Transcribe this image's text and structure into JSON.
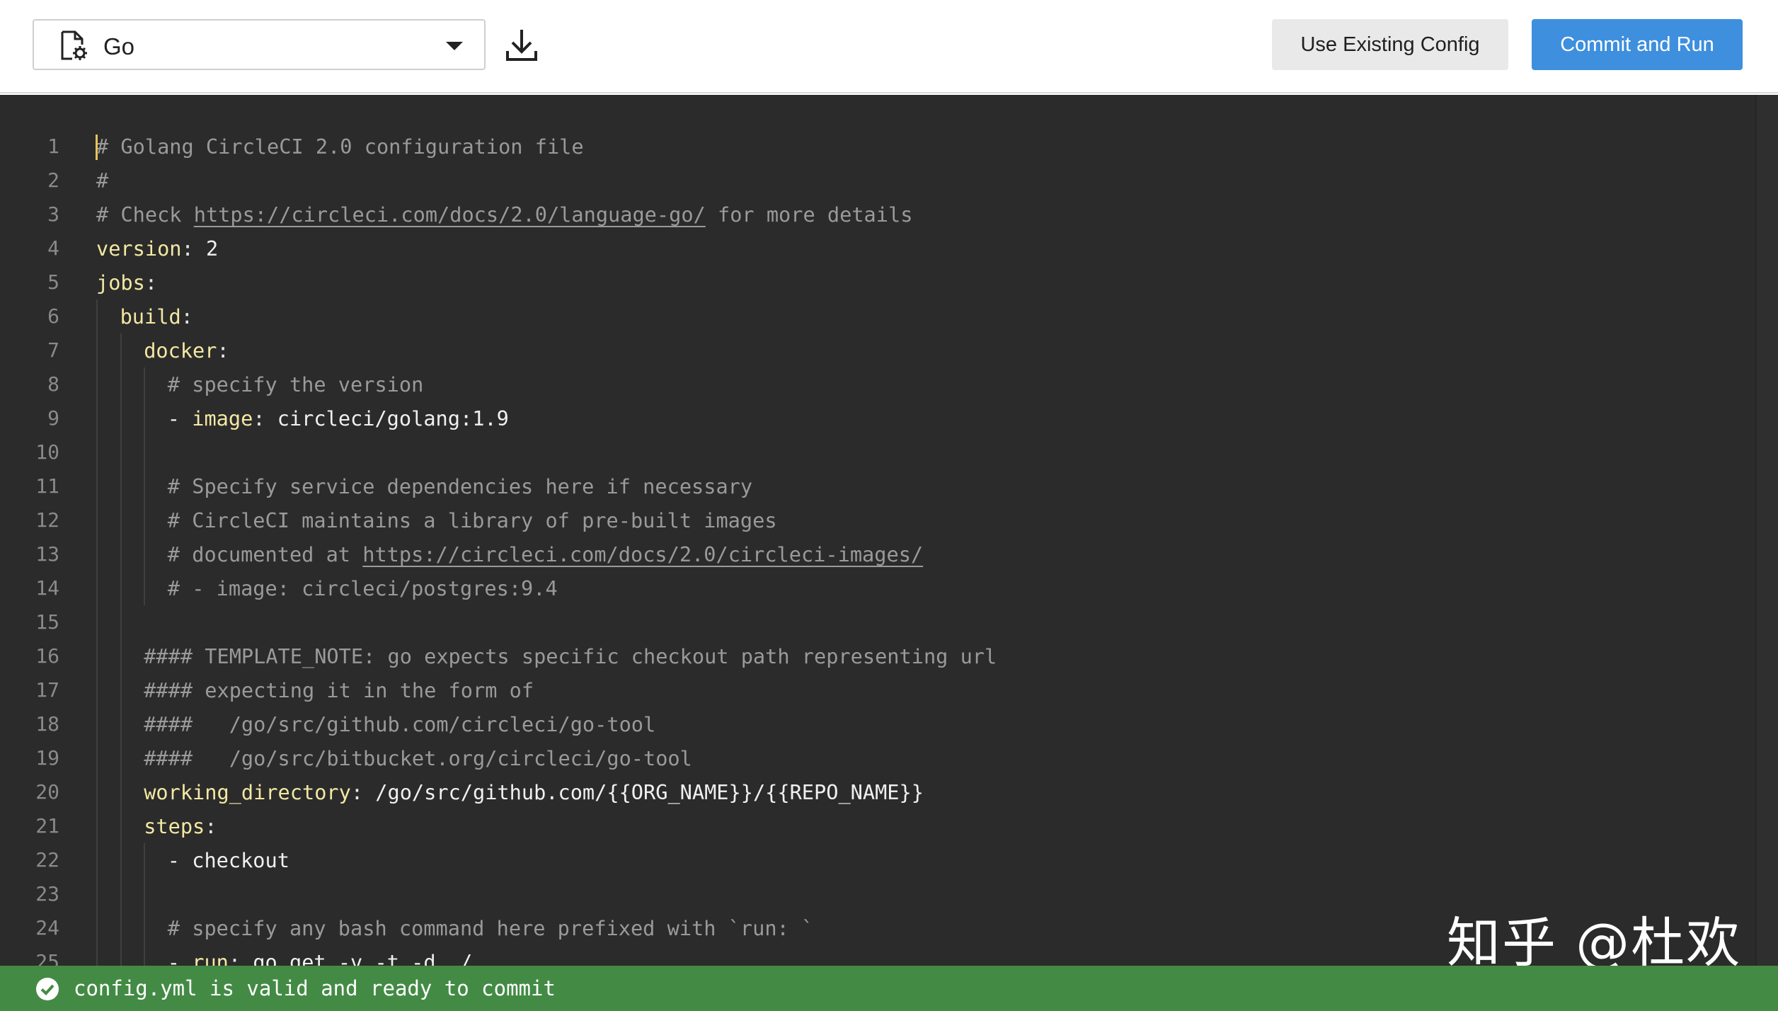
{
  "toolbar": {
    "language_select_value": "Go",
    "use_existing_label": "Use Existing Config",
    "commit_label": "Commit and Run"
  },
  "editor": {
    "lines": [
      {
        "n": "1",
        "indent": 0,
        "segs": [
          {
            "t": "# Golang CircleCI 2.0 configuration file",
            "c": "comment"
          }
        ]
      },
      {
        "n": "2",
        "indent": 0,
        "segs": [
          {
            "t": "#",
            "c": "comment"
          }
        ]
      },
      {
        "n": "3",
        "indent": 0,
        "segs": [
          {
            "t": "# Check ",
            "c": "comment"
          },
          {
            "t": "https://circleci.com/docs/2.0/language-go/",
            "c": "link"
          },
          {
            "t": " for more details",
            "c": "comment"
          }
        ]
      },
      {
        "n": "4",
        "indent": 0,
        "segs": [
          {
            "t": "version",
            "c": "key"
          },
          {
            "t": ": ",
            "c": "punct"
          },
          {
            "t": "2",
            "c": "plain"
          }
        ]
      },
      {
        "n": "5",
        "indent": 0,
        "segs": [
          {
            "t": "jobs",
            "c": "key"
          },
          {
            "t": ":",
            "c": "punct"
          }
        ]
      },
      {
        "n": "6",
        "indent": 1,
        "segs": [
          {
            "t": "build",
            "c": "key"
          },
          {
            "t": ":",
            "c": "punct"
          }
        ]
      },
      {
        "n": "7",
        "indent": 2,
        "segs": [
          {
            "t": "docker",
            "c": "key"
          },
          {
            "t": ":",
            "c": "punct"
          }
        ]
      },
      {
        "n": "8",
        "indent": 3,
        "segs": [
          {
            "t": "# specify the version",
            "c": "comment"
          }
        ]
      },
      {
        "n": "9",
        "indent": 3,
        "segs": [
          {
            "t": "- ",
            "c": "plain"
          },
          {
            "t": "image",
            "c": "key"
          },
          {
            "t": ": ",
            "c": "punct"
          },
          {
            "t": "circleci/golang:1.9",
            "c": "plain"
          }
        ]
      },
      {
        "n": "10",
        "indent": 3,
        "segs": []
      },
      {
        "n": "11",
        "indent": 3,
        "segs": [
          {
            "t": "# Specify service dependencies here if necessary",
            "c": "comment"
          }
        ]
      },
      {
        "n": "12",
        "indent": 3,
        "segs": [
          {
            "t": "# CircleCI maintains a library of pre-built images",
            "c": "comment"
          }
        ]
      },
      {
        "n": "13",
        "indent": 3,
        "segs": [
          {
            "t": "# documented at ",
            "c": "comment"
          },
          {
            "t": "https://circleci.com/docs/2.0/circleci-images/",
            "c": "link"
          }
        ]
      },
      {
        "n": "14",
        "indent": 3,
        "segs": [
          {
            "t": "# - image: circleci/postgres:9.4",
            "c": "comment"
          }
        ]
      },
      {
        "n": "15",
        "indent": 2,
        "segs": []
      },
      {
        "n": "16",
        "indent": 2,
        "segs": [
          {
            "t": "#### TEMPLATE_NOTE: go expects specific checkout path representing url",
            "c": "comment"
          }
        ]
      },
      {
        "n": "17",
        "indent": 2,
        "segs": [
          {
            "t": "#### expecting it in the form of",
            "c": "comment"
          }
        ]
      },
      {
        "n": "18",
        "indent": 2,
        "segs": [
          {
            "t": "####   /go/src/github.com/circleci/go-tool",
            "c": "comment"
          }
        ]
      },
      {
        "n": "19",
        "indent": 2,
        "segs": [
          {
            "t": "####   /go/src/bitbucket.org/circleci/go-tool",
            "c": "comment"
          }
        ]
      },
      {
        "n": "20",
        "indent": 2,
        "segs": [
          {
            "t": "working_directory",
            "c": "key"
          },
          {
            "t": ": ",
            "c": "punct"
          },
          {
            "t": "/go/src/github.com/{{ORG_NAME}}/{{REPO_NAME}}",
            "c": "plain"
          }
        ]
      },
      {
        "n": "21",
        "indent": 2,
        "segs": [
          {
            "t": "steps",
            "c": "key"
          },
          {
            "t": ":",
            "c": "punct"
          }
        ]
      },
      {
        "n": "22",
        "indent": 3,
        "segs": [
          {
            "t": "- checkout",
            "c": "plain"
          }
        ]
      },
      {
        "n": "23",
        "indent": 3,
        "segs": []
      },
      {
        "n": "24",
        "indent": 3,
        "segs": [
          {
            "t": "# specify any bash command here prefixed with `run: `",
            "c": "comment"
          }
        ]
      },
      {
        "n": "25",
        "indent": 3,
        "segs": [
          {
            "t": "- ",
            "c": "plain"
          },
          {
            "t": "run",
            "c": "key"
          },
          {
            "t": ": ",
            "c": "punct"
          },
          {
            "t": "go get -v -t -d ./...",
            "c": "plain"
          }
        ]
      }
    ]
  },
  "watermark": "知乎 @杜欢",
  "status": {
    "message": "config.yml is valid and ready to commit",
    "color": "#438b45"
  },
  "colors": {
    "accent": "#3e8fde",
    "editor_bg": "#2b2b2b",
    "key": "#f3e8a4",
    "comment": "#9a9a9a"
  }
}
